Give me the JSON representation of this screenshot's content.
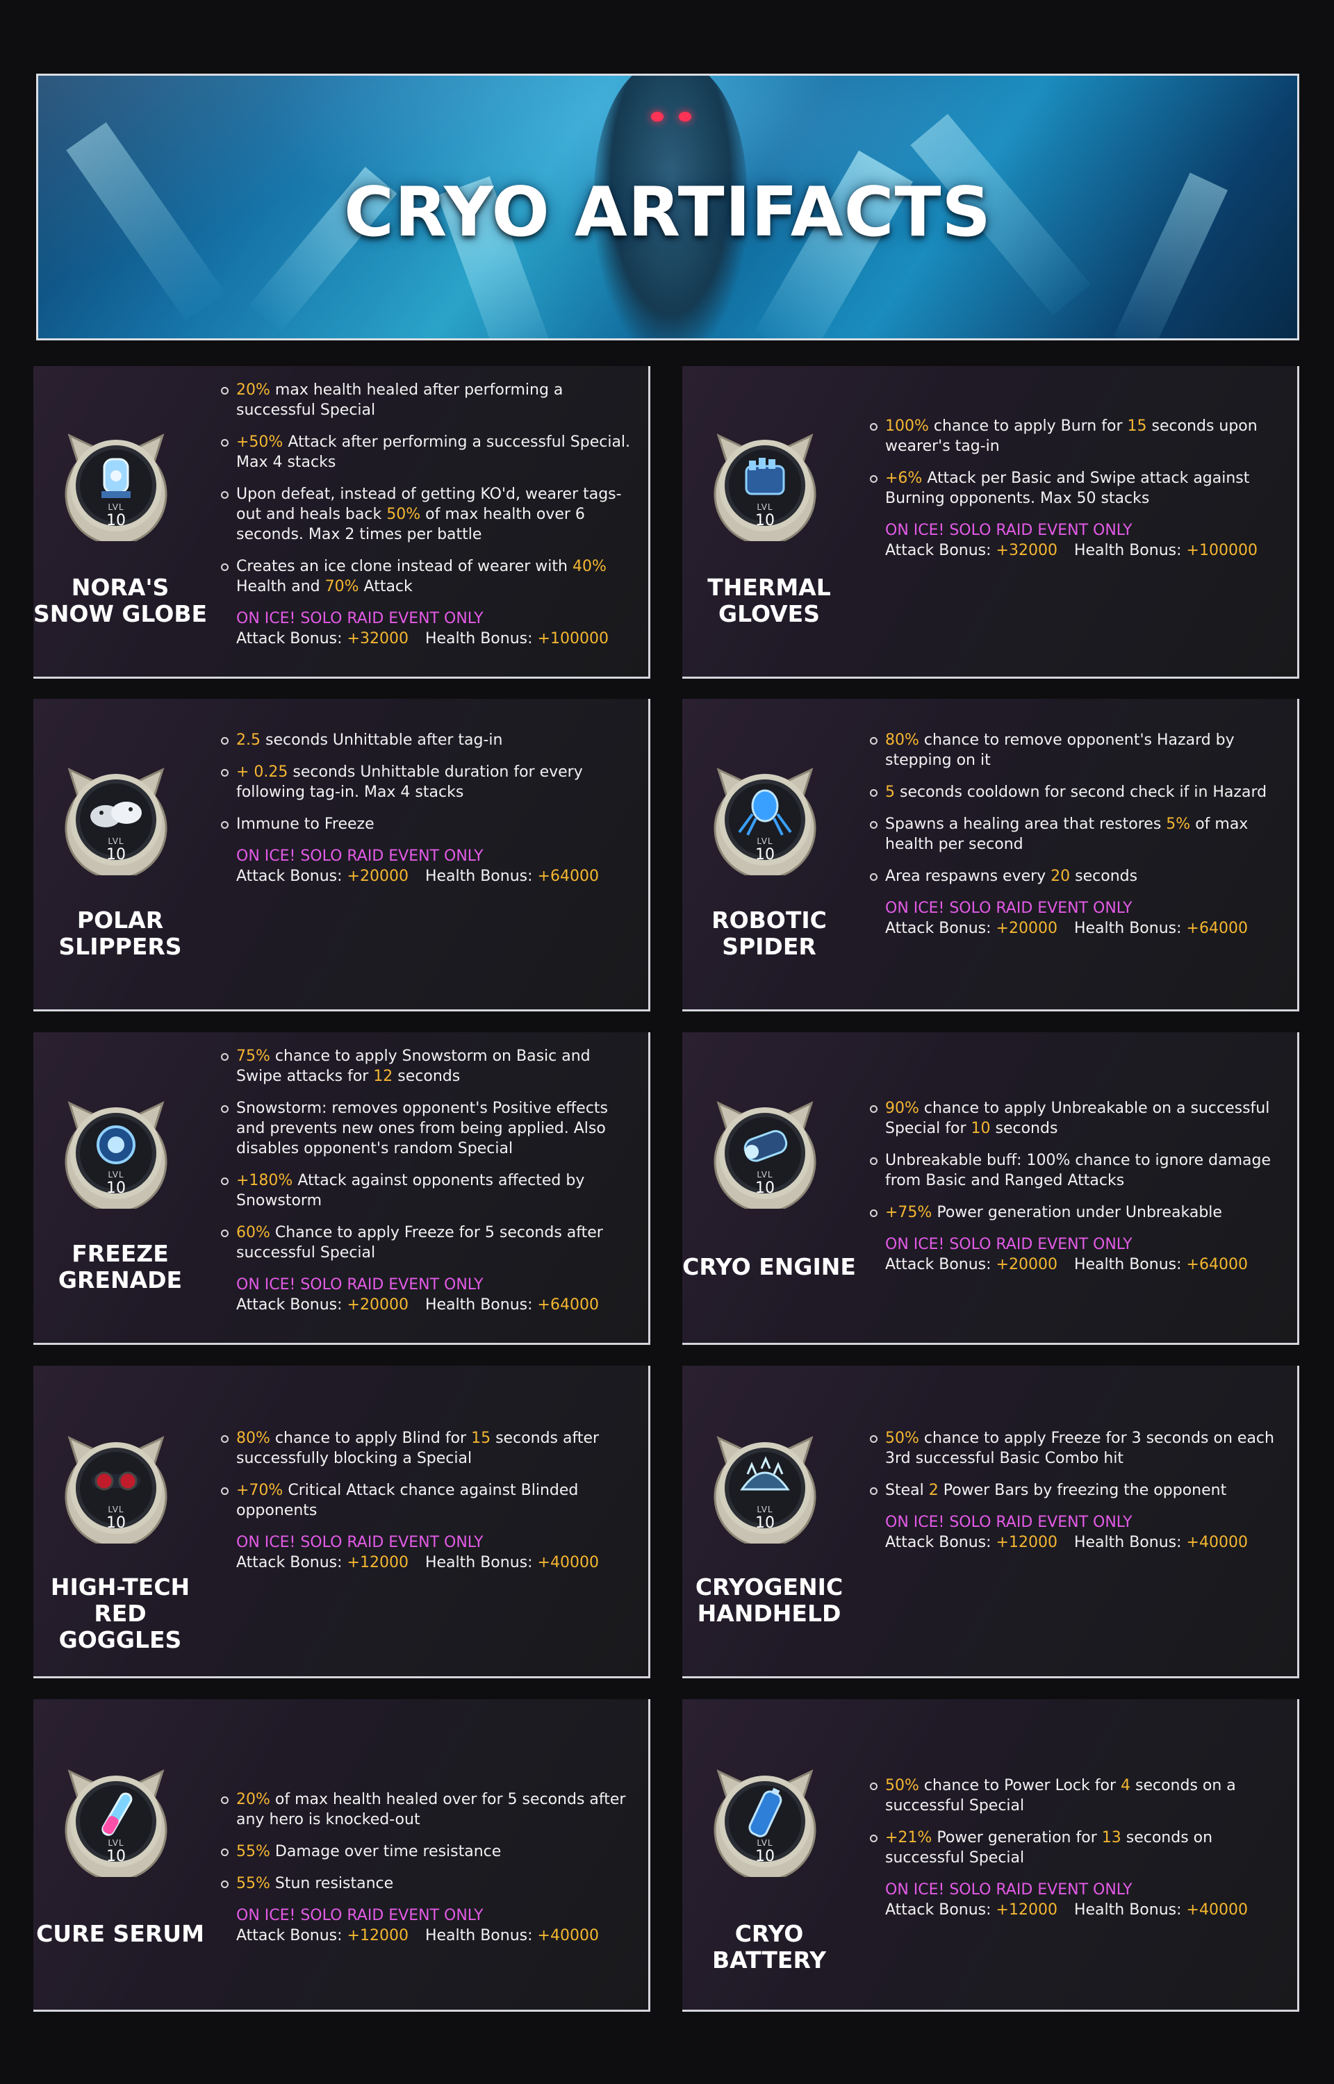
{
  "title": "CRYO ARTIFACTS",
  "colors": {
    "highlight": "#f5b731",
    "event": "#e35be6",
    "card_border": "#d4d6dc"
  },
  "lvl_label": "LVL",
  "event_label": "ON ICE! SOLO RAID EVENT ONLY",
  "attack_label": "Attack Bonus:",
  "health_label": "Health Bonus:",
  "artifacts": [
    {
      "name": "NORA'S\nSNOW GLOBE",
      "icon": "snow-globe-icon",
      "level": "10",
      "perks": [
        [
          [
            "hl",
            "20% "
          ],
          [
            "t",
            " max health healed after performing a successful Special"
          ]
        ],
        [
          [
            "hl",
            "+50%"
          ],
          [
            "t",
            " Attack after performing a successful Special. Max 4 stacks"
          ]
        ],
        [
          [
            "t",
            "Upon defeat, instead of getting KO'd, wearer tags-out and heals back "
          ],
          [
            "hl",
            "50%"
          ],
          [
            "t",
            " of max health over 6 seconds. Max 2 times per battle"
          ]
        ],
        [
          [
            "t",
            "Creates an ice clone instead of wearer with "
          ],
          [
            "hl",
            "40%"
          ],
          [
            "t",
            " Health and "
          ],
          [
            "hl",
            "70%"
          ],
          [
            "t",
            " Attack"
          ]
        ]
      ],
      "attack_bonus": "+32000",
      "health_bonus": "+100000"
    },
    {
      "name": "THERMAL\nGLOVES",
      "icon": "gauntlet-icon",
      "level": "10",
      "perks": [
        [
          [
            "hl",
            "100%"
          ],
          [
            "t",
            " chance to apply Burn for "
          ],
          [
            "hl",
            "15"
          ],
          [
            "t",
            " seconds upon wearer's tag-in"
          ]
        ],
        [
          [
            "hl",
            "+6%"
          ],
          [
            "t",
            " Attack per Basic and Swipe attack against Burning opponents. Max 50 stacks"
          ]
        ]
      ],
      "attack_bonus": "+32000",
      "health_bonus": "+100000"
    },
    {
      "name": "POLAR\nSLIPPERS",
      "icon": "slippers-icon",
      "level": "10",
      "perks": [
        [
          [
            "hl",
            "2.5"
          ],
          [
            "t",
            " seconds Unhittable after tag-in"
          ]
        ],
        [
          [
            "hl",
            "+ 0.25"
          ],
          [
            "t",
            " seconds Unhittable duration for every following tag-in. Max 4 stacks"
          ]
        ],
        [
          [
            "t",
            "Immune to Freeze"
          ]
        ]
      ],
      "attack_bonus": "+20000",
      "health_bonus": "+64000"
    },
    {
      "name": "ROBOTIC\nSPIDER",
      "icon": "robot-spider-icon",
      "level": "10",
      "perks": [
        [
          [
            "hl",
            "80% "
          ],
          [
            "t",
            " chance to remove opponent's Hazard by stepping on it"
          ]
        ],
        [
          [
            "hl",
            "5"
          ],
          [
            "t",
            " seconds cooldown for second check if in Hazard"
          ]
        ],
        [
          [
            "t",
            "Spawns a healing area that restores "
          ],
          [
            "hl",
            "5%"
          ],
          [
            "t",
            " of max health per second"
          ]
        ],
        [
          [
            "t",
            "Area respawns every "
          ],
          [
            "hl",
            "20"
          ],
          [
            "t",
            " seconds"
          ]
        ]
      ],
      "attack_bonus": "+20000",
      "health_bonus": "+64000"
    },
    {
      "name": "FREEZE\nGRENADE",
      "icon": "grenade-icon",
      "level": "10",
      "perks": [
        [
          [
            "hl",
            "75%"
          ],
          [
            "t",
            " chance to apply Snowstorm on Basic and Swipe attacks for "
          ],
          [
            "hl",
            "12"
          ],
          [
            "t",
            " seconds"
          ]
        ],
        [
          [
            "t",
            "Snowstorm: removes opponent's Positive effects and prevents new ones from being applied. Also disables opponent's random Special"
          ]
        ],
        [
          [
            "hl",
            "+180%"
          ],
          [
            "t",
            " Attack against opponents affected by Snowstorm"
          ]
        ],
        [
          [
            "hl",
            "60%"
          ],
          [
            "t",
            " Chance to apply Freeze for 5 seconds after successful Special"
          ]
        ]
      ],
      "attack_bonus": "+20000",
      "health_bonus": "+64000"
    },
    {
      "name": "CRYO ENGINE",
      "icon": "engine-icon",
      "level": "10",
      "perks": [
        [
          [
            "hl",
            "90%"
          ],
          [
            "t",
            " chance to apply Unbreakable on a successful Special for "
          ],
          [
            "hl",
            "10"
          ],
          [
            "t",
            " seconds"
          ]
        ],
        [
          [
            "t",
            "Unbreakable buff: 100% chance to ignore damage from Basic and Ranged Attacks"
          ]
        ],
        [
          [
            "hl",
            "+75%"
          ],
          [
            "t",
            " Power generation under Unbreakable"
          ]
        ]
      ],
      "attack_bonus": "+20000",
      "health_bonus": "+64000"
    },
    {
      "name": "HIGH-TECH RED\nGOGGLES",
      "icon": "goggles-icon",
      "level": "10",
      "perks": [
        [
          [
            "hl",
            "80%"
          ],
          [
            "t",
            " chance to apply Blind for "
          ],
          [
            "hl",
            "15"
          ],
          [
            "t",
            " seconds after successfully blocking a Special"
          ]
        ],
        [
          [
            "hl",
            "+70%"
          ],
          [
            "t",
            " Critical Attack chance against Blinded opponents"
          ]
        ]
      ],
      "attack_bonus": "+12000",
      "health_bonus": "+40000"
    },
    {
      "name": "CRYOGENIC\nHANDHELD",
      "icon": "handheld-icon",
      "level": "10",
      "perks": [
        [
          [
            "hl",
            "50%"
          ],
          [
            "t",
            " chance to apply Freeze for 3 seconds on each 3rd successful Basic Combo hit"
          ]
        ],
        [
          [
            "t",
            "Steal "
          ],
          [
            "hl",
            "2"
          ],
          [
            "t",
            " Power Bars by freezing the opponent"
          ]
        ]
      ],
      "attack_bonus": "+12000",
      "health_bonus": "+40000"
    },
    {
      "name": "CURE SERUM",
      "icon": "serum-vial-icon",
      "level": "10",
      "perks": [
        [
          [
            "hl",
            "20%"
          ],
          [
            "t",
            " of max health healed over for 5 seconds after any hero is knocked-out"
          ]
        ],
        [
          [
            "hl",
            "55%"
          ],
          [
            "t",
            " Damage over time resistance"
          ]
        ],
        [
          [
            "hl",
            "55%"
          ],
          [
            "t",
            " Stun resistance"
          ]
        ]
      ],
      "attack_bonus": "+12000",
      "health_bonus": "+40000"
    },
    {
      "name": "CRYO BATTERY",
      "icon": "battery-icon",
      "level": "10",
      "perks": [
        [
          [
            "hl",
            "50%"
          ],
          [
            "t",
            " chance to Power Lock for "
          ],
          [
            "hl",
            "4"
          ],
          [
            "t",
            " seconds on a successful Special"
          ]
        ],
        [
          [
            "hl",
            "+21%"
          ],
          [
            "t",
            " Power generation for "
          ],
          [
            "hl",
            "13"
          ],
          [
            "t",
            " seconds on successful Special"
          ]
        ]
      ],
      "attack_bonus": "+12000",
      "health_bonus": "+40000"
    }
  ]
}
